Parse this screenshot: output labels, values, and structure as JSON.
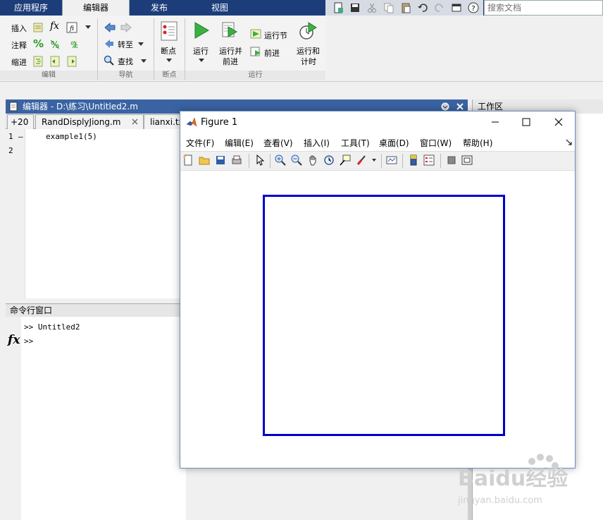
{
  "top_tabs": [
    "应用程序",
    "编辑器",
    "发布",
    "视图"
  ],
  "search": {
    "placeholder": "搜索文档"
  },
  "ribbon": {
    "edit": {
      "insert": "插入",
      "comment": "注释",
      "indent": "缩进",
      "fx": "fx",
      "group": "编辑"
    },
    "navigate": {
      "goto": "转至",
      "find": "查找",
      "group": "导航"
    },
    "breakpoints": {
      "label": "断点",
      "group": "断点"
    },
    "run": {
      "run": "运行",
      "run_advance_1": "运行并",
      "run_advance_2": "前进",
      "run_section": "运行节",
      "advance": "前进",
      "run_time_1": "运行和",
      "run_time_2": "计时",
      "group": "运行"
    }
  },
  "editor": {
    "title": "编辑器 - D:\\练习\\Untitled2.m",
    "tabs": [
      "+20",
      "RandDisplyJiong.m",
      "lianxi.txt"
    ],
    "lines": [
      {
        "num": "1",
        "marker": "–",
        "code": "example1(5)"
      },
      {
        "num": "2",
        "marker": "",
        "code": ""
      }
    ]
  },
  "command_window": {
    "title": "命令行窗口",
    "lines": [
      ">> Untitled2",
      ">>"
    ],
    "fx": "fx"
  },
  "workspace": {
    "title": "工作区"
  },
  "figure": {
    "title": "Figure 1",
    "menu": [
      "文件(F)",
      "编辑(E)",
      "查看(V)",
      "插入(I)",
      "工具(T)",
      "桌面(D)",
      "窗口(W)",
      "帮助(H)"
    ]
  },
  "watermark": {
    "brand": "Baidu经验",
    "url": "jingyan.baidu.com"
  },
  "colors": {
    "titlebar": "#1c3d7a",
    "plot_border": "#0000cc",
    "editor_title": "#3a63a3"
  }
}
